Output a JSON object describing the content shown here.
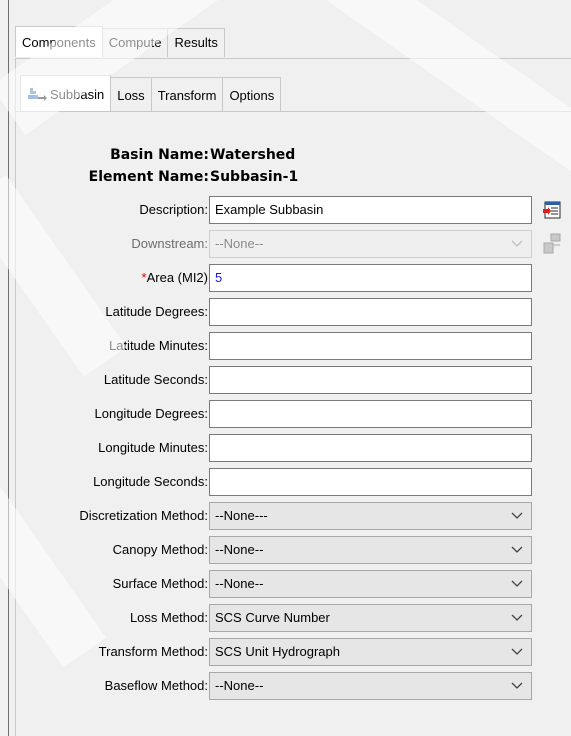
{
  "top_tabs": [
    "Components",
    "Compute",
    "Results"
  ],
  "sub_tabs": [
    "Subbasin",
    "Loss",
    "Transform",
    "Options"
  ],
  "basin": {
    "label": "Basin Name:",
    "value": "Watershed"
  },
  "element": {
    "label": "Element Name:",
    "value": "Subbasin-1"
  },
  "description": {
    "label": "Description:",
    "value": "Example Subbasin"
  },
  "downstream": {
    "label": "Downstream:",
    "value": "--None--"
  },
  "area": {
    "required_mark": "*",
    "label": "Area (MI2)",
    "value": "5"
  },
  "coords": [
    {
      "label": "Latitude Degrees:",
      "value": ""
    },
    {
      "label": "Latitude Minutes:",
      "value": ""
    },
    {
      "label": "Latitude Seconds:",
      "value": ""
    },
    {
      "label": "Longitude Degrees:",
      "value": ""
    },
    {
      "label": "Longitude Minutes:",
      "value": ""
    },
    {
      "label": "Longitude Seconds:",
      "value": ""
    }
  ],
  "methods": [
    {
      "label": "Discretization Method:",
      "value": "--None---"
    },
    {
      "label": "Canopy Method:",
      "value": "--None--"
    },
    {
      "label": "Surface Method:",
      "value": "--None--"
    },
    {
      "label": "Loss Method:",
      "value": "SCS Curve Number"
    },
    {
      "label": "Transform Method:",
      "value": "SCS Unit Hydrograph"
    },
    {
      "label": "Baseflow Method:",
      "value": "--None--"
    }
  ],
  "icons": {
    "subbasin_tab": "subbasin-icon",
    "description_button": "edit-description-icon",
    "downstream_button": "select-element-icon",
    "dropdown": "chevron-down-icon"
  },
  "colors": {
    "required": "#e00000",
    "value_text": "#1a1adb"
  }
}
